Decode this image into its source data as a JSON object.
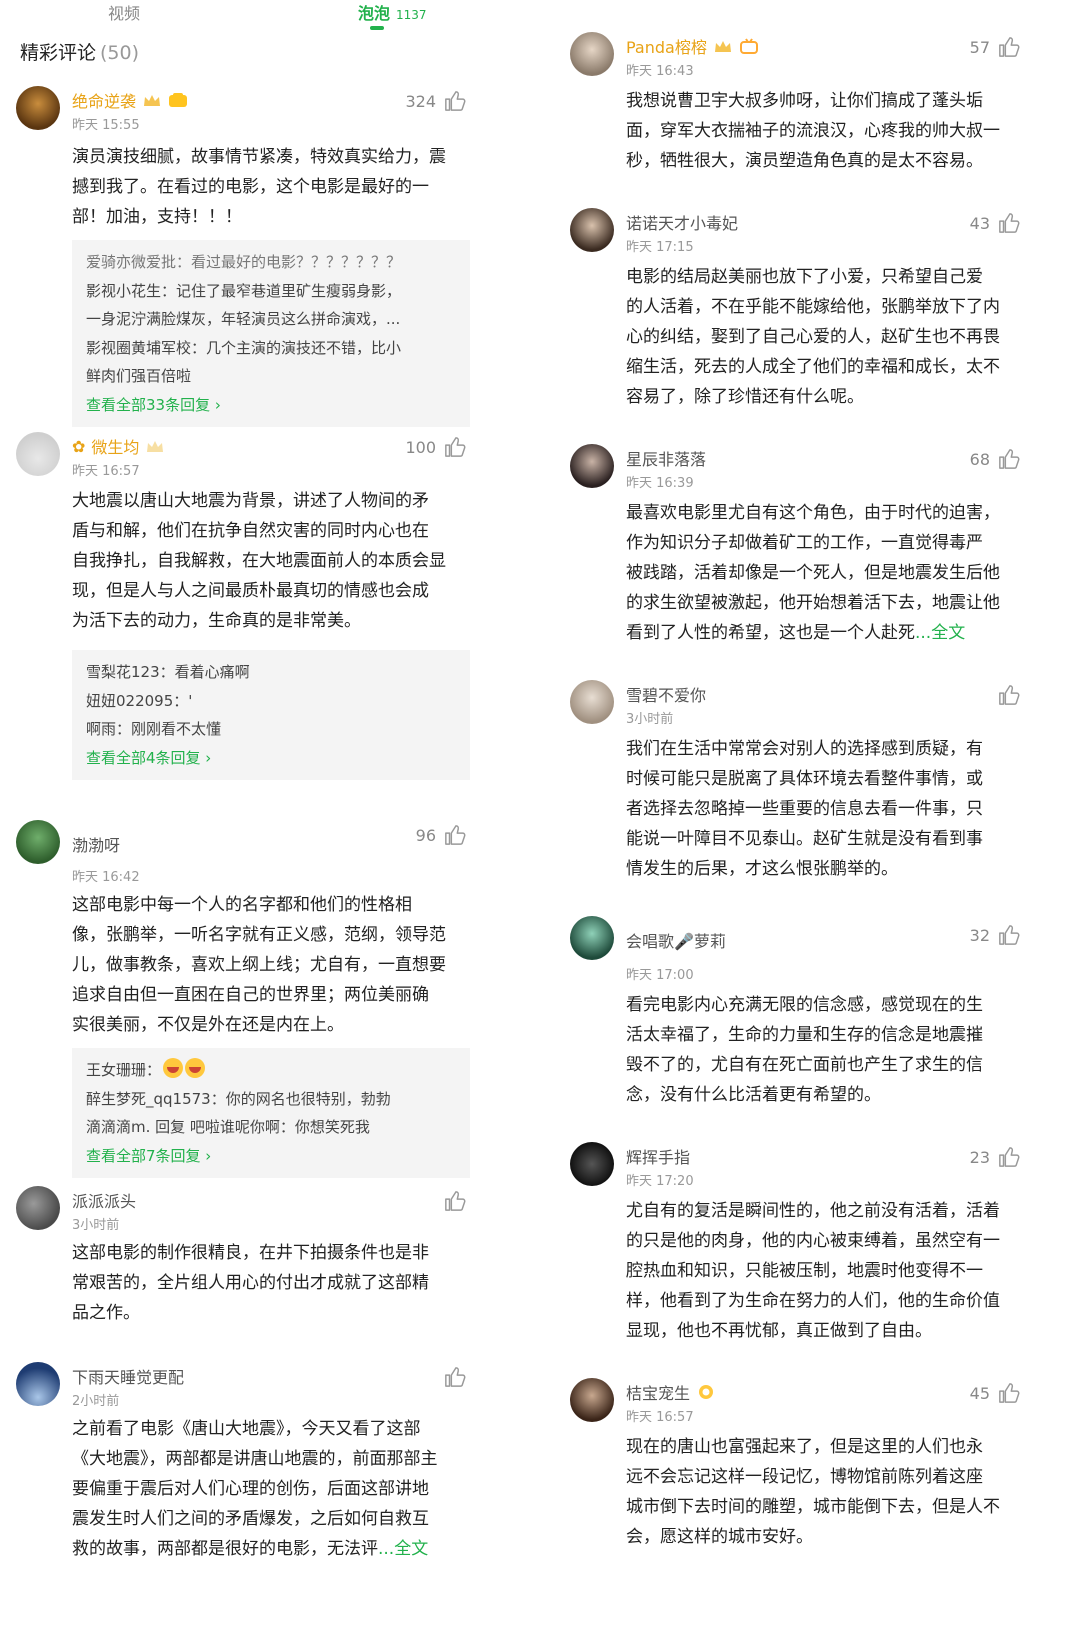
{
  "tabs": {
    "video": "视频",
    "bubble": "泡泡",
    "bubble_count": "1137"
  },
  "section": {
    "title": "精彩评论",
    "count": "(50)"
  },
  "left": [
    {
      "name": "绝命逆袭",
      "gold": true,
      "time": "昨天 15:55",
      "likes": "324",
      "lines": [
        "演员演技细腻，故事情节紧凑，特效真实给力，震",
        "撼到我了。在看过的电影，这个电影是最好的一",
        "部！加油，支持！！！"
      ],
      "replies": [
        {
          "line": "爱骑亦微爱批：看过最好的电影？？？？？？？"
        },
        {
          "line": "影视小花生：记住了最窄巷道里矿生瘦弱身影，"
        },
        {
          "line": "一身泥泞满脸煤灰，年轻演员这么拼命演戏，..."
        },
        {
          "line": "影视圈黄埔军校：几个主演的演技还不错，比小"
        },
        {
          "line": "鲜肉们强百倍啦"
        }
      ],
      "more": "查看全部33条回复 ›"
    },
    {
      "name": "微生均",
      "gold": true,
      "time": "昨天 16:57",
      "likes": "100",
      "lines": [
        "大地震以唐山大地震为背景，讲述了人物间的矛",
        "盾与和解，他们在抗争自然灾害的同时内心也在",
        "自我挣扎，自我解救，在大地震面前人的本质会显",
        "现，但是人与人之间最质朴最真切的情感也会成",
        "为活下去的动力，生命真的是非常美。"
      ],
      "replies": [
        {
          "line": "雪梨花123：看着心痛啊"
        },
        {
          "line": "妞妞022095：'"
        },
        {
          "line": "啊雨：刚刚看不太懂"
        }
      ],
      "more": "查看全部4条回复 ›"
    },
    {
      "name": "渤渤呀",
      "gold": false,
      "time": "昨天 16:42",
      "likes": "96",
      "lines": [
        "这部电影中每一个人的名字都和他们的性格相",
        "像，张鹏举，一听名字就有正义感，范纲，领导范",
        "儿，做事教条，喜欢上纲上线；尤自有，一直想要",
        "追求自由但一直困在自己的世界里；两位美丽确",
        "实很美丽，不仅是外在还是内在上。"
      ],
      "replies": [
        {
          "line": "王女珊珊："
        },
        {
          "line": "醉生梦死_qq1573：你的网名也很特别，勃勃"
        },
        {
          "line": "滴滴滴m. 回复 吧啦谁呢你啊：你想笑死我"
        }
      ],
      "more": "查看全部7条回复 ›"
    },
    {
      "name": "派派派头",
      "gold": false,
      "time": "3小时前",
      "likes": "",
      "lines": [
        "这部电影的制作很精良，在井下拍摄条件也是非",
        "常艰苦的，全片组人用心的付出才成就了这部精",
        "品之作。"
      ]
    },
    {
      "name": "下雨天睡觉更配",
      "gold": false,
      "time": "2小时前",
      "likes": "",
      "lines": [
        "之前看了电影《唐山大地震》，今天又看了这部",
        "《大地震》，两部都是讲唐山地震的，前面那部主",
        "要偏重于震后对人们心理的创伤，后面这部讲地",
        "震发生时人们之间的矛盾爆发，之后如何自救互",
        "救的故事，两部都是很好的电影，无法评"
      ],
      "full": "...全文"
    }
  ],
  "right": [
    {
      "name": "Panda榕榕",
      "gold": true,
      "time": "昨天 16:43",
      "likes": "57",
      "lines": [
        "我想说曹卫宇大叔多帅呀，让你们搞成了蓬头垢",
        "面，穿军大衣揣袖子的流浪汉，心疼我的帅大叔一",
        "秒，牺牲很大，演员塑造角色真的是太不容易。"
      ]
    },
    {
      "name": "诺诺天才小毒妃",
      "gold": false,
      "time": "昨天 17:15",
      "likes": "43",
      "lines": [
        "电影的结局赵美丽也放下了小爱，只希望自己爱",
        "的人活着，不在乎能不能嫁给他，张鹏举放下了内",
        "心的纠结，娶到了自己心爱的人，赵矿生也不再畏",
        "缩生活，死去的人成全了他们的幸福和成长，太不",
        "容易了，除了珍惜还有什么呢。"
      ]
    },
    {
      "name": "星辰非落落",
      "gold": false,
      "time": "昨天 16:39",
      "likes": "68",
      "lines": [
        "最喜欢电影里尤自有这个角色，由于时代的迫害，",
        "作为知识分子却做着矿工的工作，一直觉得毒严",
        "被践踏，活着却像是一个死人，但是地震发生后他",
        "的求生欲望被激起，他开始想着活下去，地震让他",
        "看到了人性的希望，这也是一个人赴死"
      ],
      "full": "...全文"
    },
    {
      "name": "雪碧不爱你",
      "gold": false,
      "time": "3小时前",
      "likes": "",
      "lines": [
        "我们在生活中常常会对别人的选择感到质疑，有",
        "时候可能只是脱离了具体环境去看整件事情，或",
        "者选择去忽略掉一些重要的信息去看一件事，只",
        "能说一叶障目不见泰山。赵矿生就是没有看到事",
        "情发生的后果，才这么恨张鹏举的。"
      ]
    },
    {
      "name": "会唱歌🎤萝莉",
      "gold": false,
      "time": "昨天 17:00",
      "likes": "32",
      "lines": [
        "看完电影内心充满无限的信念感，感觉现在的生",
        "活太幸福了，生命的力量和生存的信念是地震摧",
        "毁不了的，尤自有在死亡面前也产生了求生的信",
        "念，没有什么比活着更有希望的。"
      ]
    },
    {
      "name": "辉挥手指",
      "gold": false,
      "time": "昨天 17:20",
      "likes": "23",
      "lines": [
        "尤自有的复活是瞬间性的，他之前没有活着，活着",
        "的只是他的肉身，他的内心被束缚着，虽然空有一",
        "腔热血和知识，只能被压制，地震时他变得不一",
        "样，他看到了为生命在努力的人们，他的生命价值",
        "显现，他也不再忧郁，真正做到了自由。"
      ]
    },
    {
      "name": "桔宝宠生",
      "gold": false,
      "time": "昨天 16:57",
      "likes": "45",
      "lines": [
        "现在的唐山也富强起来了，但是这里的人们也永",
        "远不会忘记这样一段记忆，博物馆前陈列着这座",
        "城市倒下去时间的雕塑，城市能倒下去，但是人不",
        "会，愿这样的城市安好。"
      ]
    }
  ]
}
